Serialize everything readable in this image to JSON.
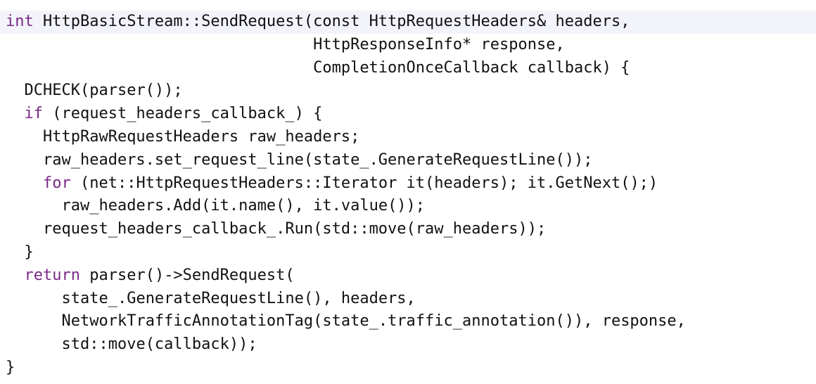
{
  "code": {
    "language": "cpp",
    "keyword_color": "#7a2a86",
    "text_color": "#111111",
    "highlight_color": "#f3f4fb",
    "lines": [
      {
        "indent": "",
        "kw": "int",
        "rest": " HttpBasicStream::SendRequest(const HttpRequestHeaders& headers,"
      },
      {
        "indent": "",
        "kw": "",
        "rest": "                                 HttpResponseInfo* response,"
      },
      {
        "indent": "",
        "kw": "",
        "rest": "                                 CompletionOnceCallback callback) {"
      },
      {
        "indent": "  ",
        "kw": "",
        "rest": "DCHECK(parser());"
      },
      {
        "indent": "  ",
        "kw": "if",
        "rest": " (request_headers_callback_) {"
      },
      {
        "indent": "    ",
        "kw": "",
        "rest": "HttpRawRequestHeaders raw_headers;"
      },
      {
        "indent": "    ",
        "kw": "",
        "rest": "raw_headers.set_request_line(state_.GenerateRequestLine());"
      },
      {
        "indent": "    ",
        "kw": "for",
        "rest": " (net::HttpRequestHeaders::Iterator it(headers); it.GetNext();)"
      },
      {
        "indent": "      ",
        "kw": "",
        "rest": "raw_headers.Add(it.name(), it.value());"
      },
      {
        "indent": "    ",
        "kw": "",
        "rest": "request_headers_callback_.Run(std::move(raw_headers));"
      },
      {
        "indent": "  ",
        "kw": "",
        "rest": "}"
      },
      {
        "indent": "  ",
        "kw": "return",
        "rest": " parser()->SendRequest("
      },
      {
        "indent": "      ",
        "kw": "",
        "rest": "state_.GenerateRequestLine(), headers,"
      },
      {
        "indent": "      ",
        "kw": "",
        "rest": "NetworkTrafficAnnotationTag(state_.traffic_annotation()), response,"
      },
      {
        "indent": "      ",
        "kw": "",
        "rest": "std::move(callback));"
      },
      {
        "indent": "",
        "kw": "",
        "rest": "}"
      }
    ]
  }
}
